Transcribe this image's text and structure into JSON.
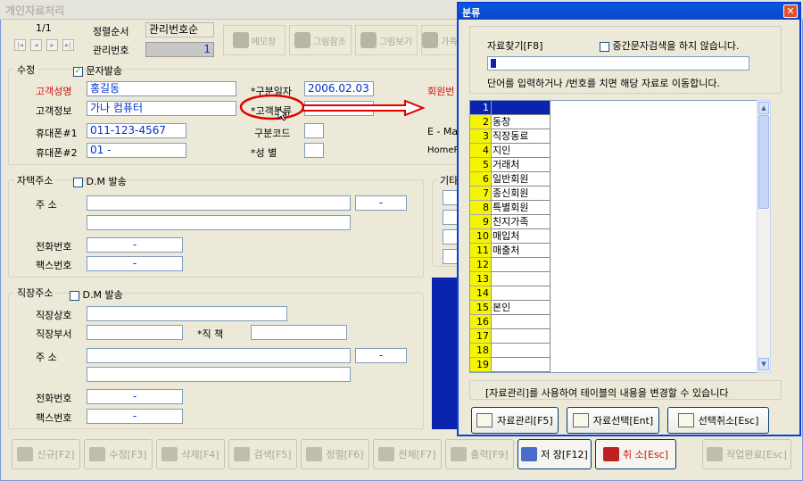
{
  "window": {
    "title": "개인자료처리"
  },
  "nav": {
    "page": "1/1"
  },
  "sort": {
    "label": "정렬순서",
    "value": "관리번호순"
  },
  "mgmt": {
    "label": "관리번호",
    "value": "1"
  },
  "toolbar": {
    "memo": "메모장",
    "image_ref": "그림참조",
    "image_view": "그림보기",
    "family": "가족"
  },
  "section_edit": {
    "title": "수정",
    "sms": "문자발송"
  },
  "customer": {
    "name_label": "고객성명",
    "name_value": "홍길동",
    "info_label": "고객정보",
    "info_value": "가나 컴퓨터",
    "phone1_label": "휴대폰#1",
    "phone1_value": "011-123-4567",
    "phone2_label": "휴대폰#2",
    "phone2_value": "01 -",
    "date_label": "*구분일자",
    "date_value": "2006.02.03",
    "class_label": "*고객분류",
    "code_label": "구분코드",
    "gender_label": "*성    별",
    "member_label": "회원번",
    "email_label": "E - Ma",
    "homepage_label": "HomePa"
  },
  "home": {
    "title": "자택주소",
    "dm": "D.M 발송",
    "addr_label": "주    소",
    "phone_label": "전화번호",
    "fax_label": "팩스번호",
    "dash": "-"
  },
  "work": {
    "title": "직장주소",
    "dm": "D.M 발송",
    "company_label": "직장상호",
    "dept_label": "직장부서",
    "position_label": "*직    책",
    "addr_label": "주    소",
    "phone_label": "전화번호",
    "fax_label": "팩스번호",
    "dash": "-"
  },
  "other": {
    "title": "기타"
  },
  "bottom": {
    "new": "신규[F2]",
    "edit": "수정[F3]",
    "delete": "삭제[F4]",
    "search": "검색[F5]",
    "sort": "정렬[F6]",
    "all": "전체[F7]",
    "print": "출력[F9]",
    "save": "저 장[F12]",
    "cancel": "취 소[Esc]",
    "done": "작업완료[Esc]"
  },
  "dialog": {
    "title": "분류",
    "close": "✕",
    "find_label": "자료찾기[F8]",
    "mid_search": "중간문자검색을 하지 않습니다.",
    "hint": "단어를 입력하거나  /번호를 치면 해당 자료로 이동합니다.",
    "footer_note": "[자료관리]를 사용하여 테이블의 내용을 변경할 수 있습니다",
    "btn_manage": "자료관리[F5]",
    "btn_select": "자료선택[Ent]",
    "btn_cancel": "선택취소[Esc]",
    "rows": [
      {
        "num": "1",
        "text": ""
      },
      {
        "num": "2",
        "text": "동창"
      },
      {
        "num": "3",
        "text": "직장동료"
      },
      {
        "num": "4",
        "text": "지인"
      },
      {
        "num": "5",
        "text": "거래처"
      },
      {
        "num": "6",
        "text": "일반회원"
      },
      {
        "num": "7",
        "text": "종신회원"
      },
      {
        "num": "8",
        "text": "특별회원"
      },
      {
        "num": "9",
        "text": "친지가족"
      },
      {
        "num": "10",
        "text": "매입처"
      },
      {
        "num": "11",
        "text": "매출처"
      },
      {
        "num": "12",
        "text": ""
      },
      {
        "num": "13",
        "text": ""
      },
      {
        "num": "14",
        "text": ""
      },
      {
        "num": "15",
        "text": "본인"
      },
      {
        "num": "16",
        "text": ""
      },
      {
        "num": "17",
        "text": ""
      },
      {
        "num": "18",
        "text": ""
      },
      {
        "num": "19",
        "text": ""
      }
    ]
  },
  "colors": {
    "accent_red": "#d01010",
    "dialog_blue": "#0a45c8",
    "row_yellow": "#f5f500",
    "selection_blue": "#0a24b0"
  }
}
